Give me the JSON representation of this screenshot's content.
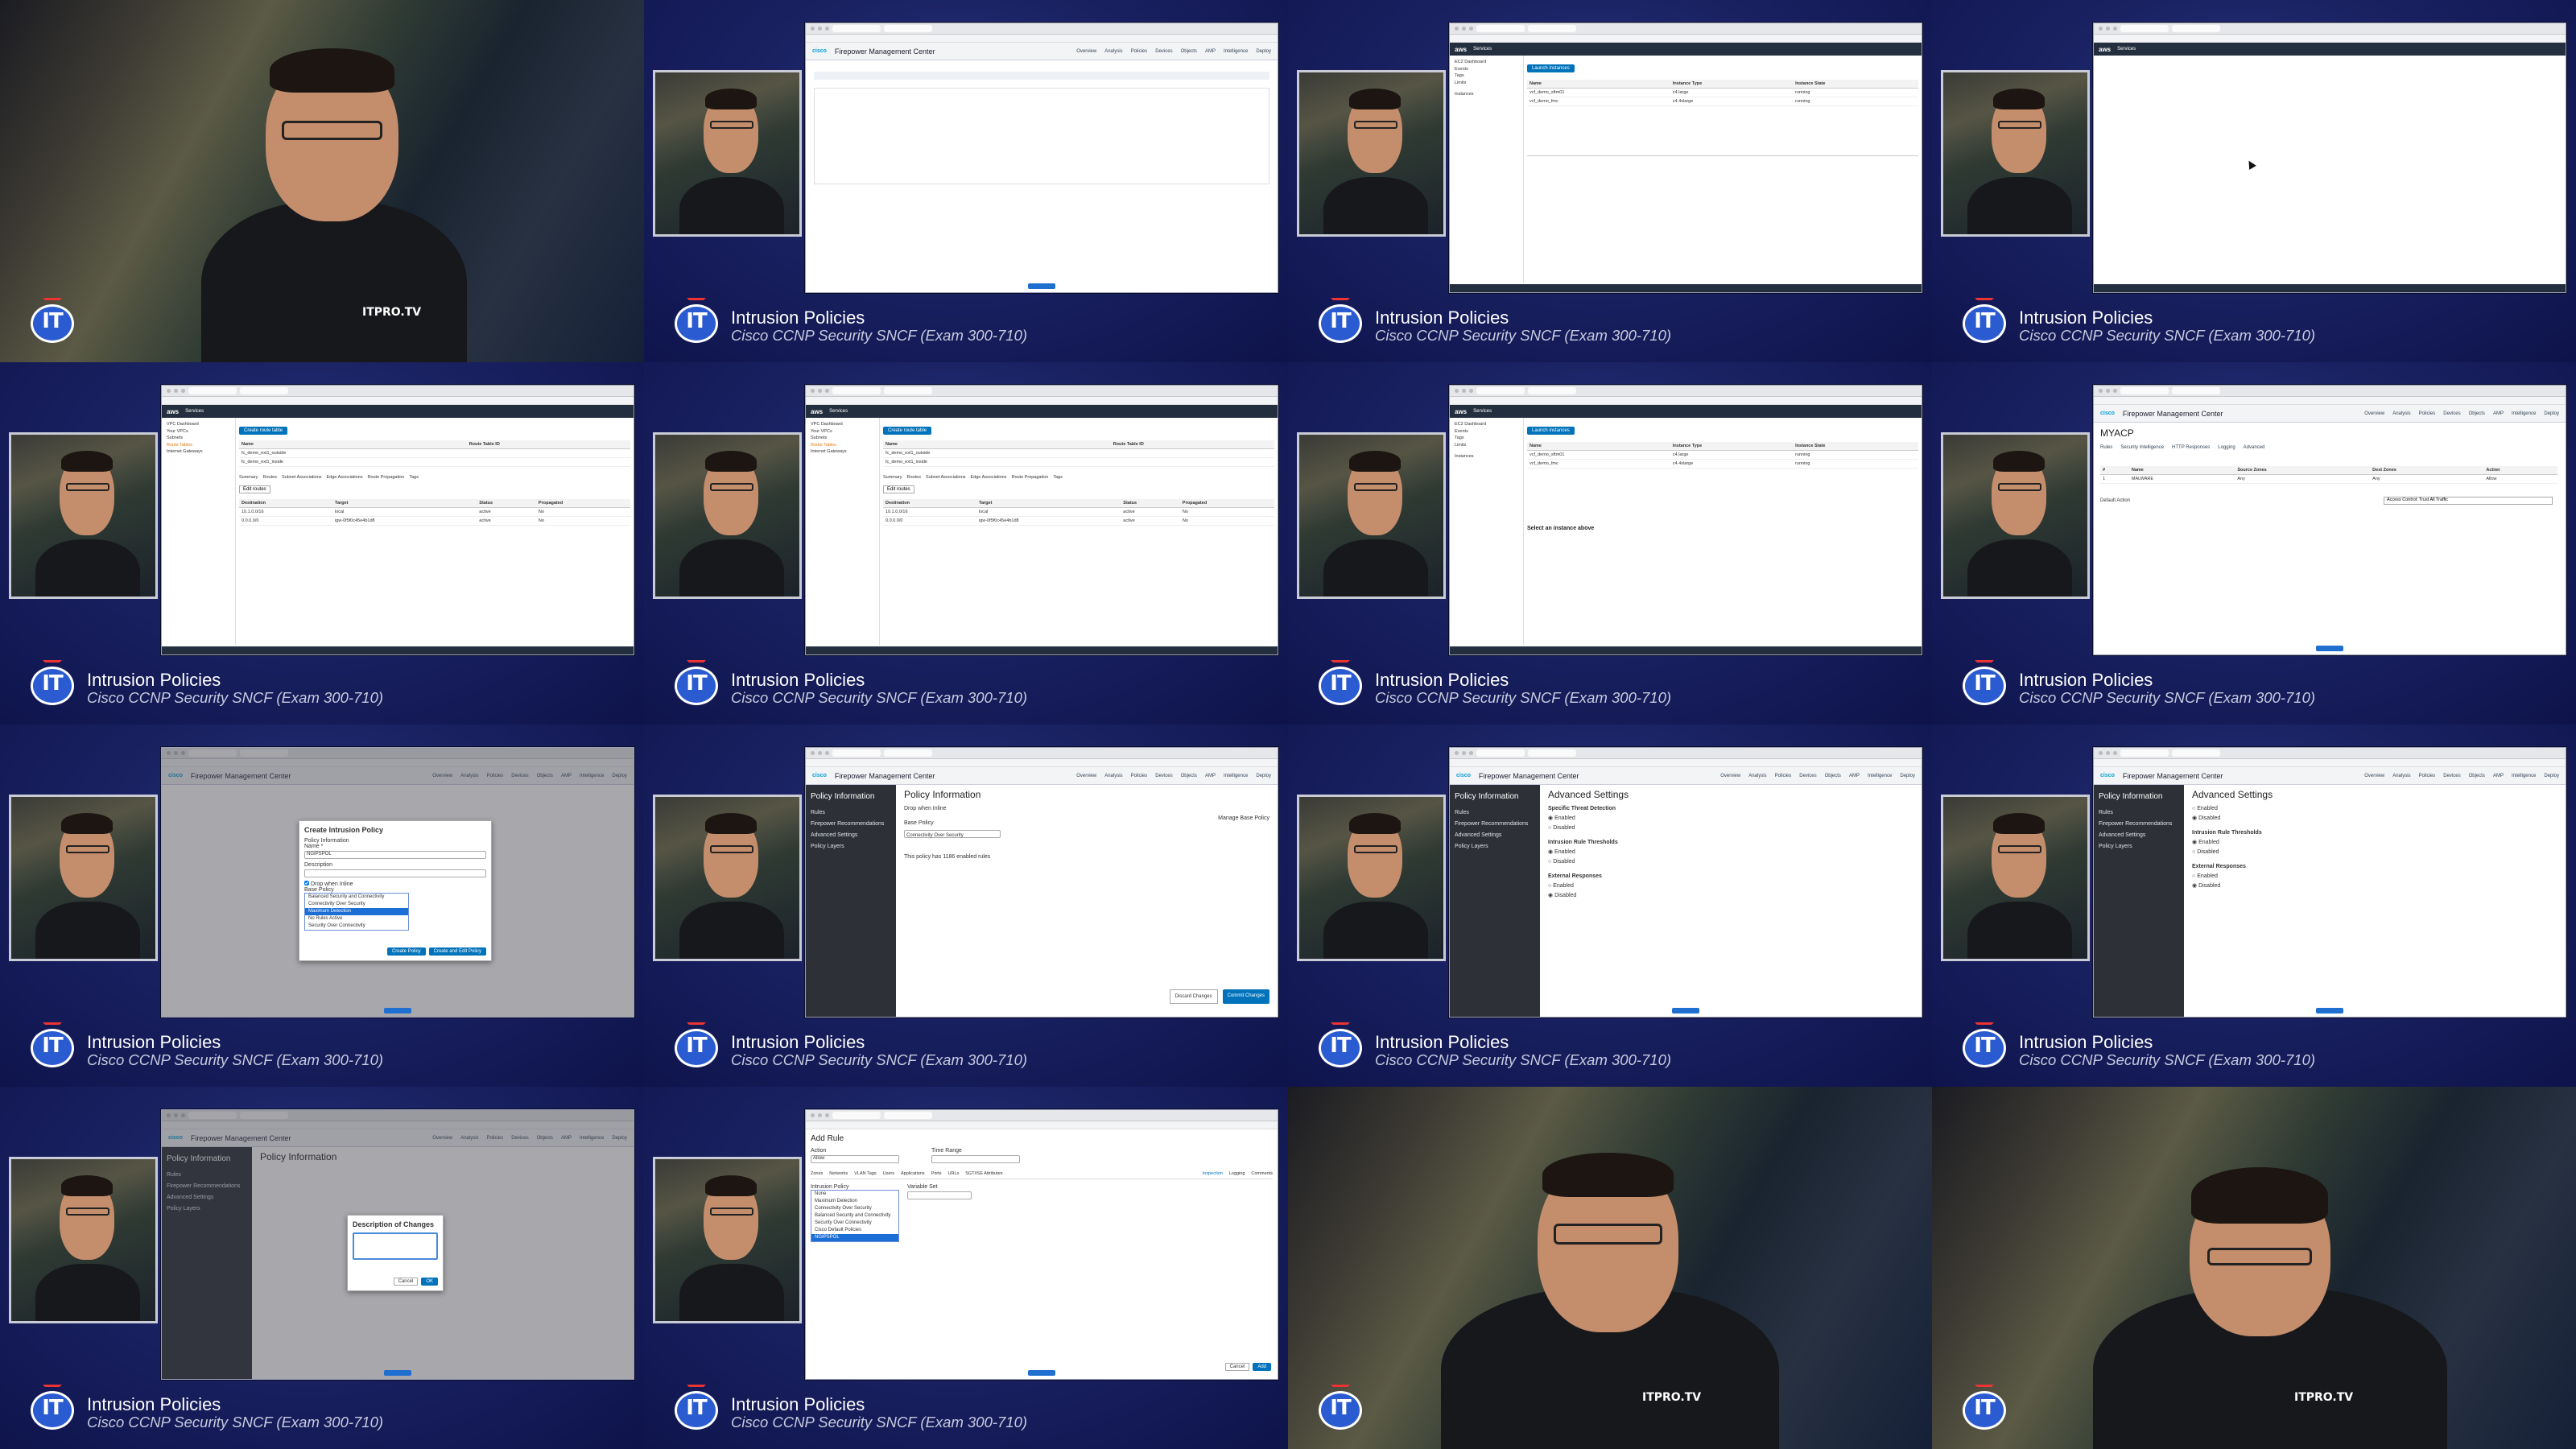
{
  "tile_title": "Intrusion Policies",
  "tile_subtitle": "Cisco CCNP Security SNCF (Exam 300-710)",
  "brand": {
    "mark": "IT",
    "shirt_logo": "ITPRO.TV"
  },
  "fmc": {
    "app_title": "Firepower Management Center",
    "nav": [
      "Overview",
      "Analysis",
      "Policies",
      "Devices",
      "Objects",
      "AMP",
      "Intelligence",
      "Deploy"
    ]
  },
  "aws": {
    "logo": "aws",
    "services": "Services",
    "ec2_dashboard": "EC2 Dashboard",
    "launch_instances": "Launch instances",
    "create_route_table": "Create route table",
    "instances_label": "Instances",
    "route_tables": "Route Tables",
    "edit_routes": "Edit routes",
    "select_instance": "Select an instance above",
    "instances": [
      {
        "name": "vcf_demo_sftm01",
        "type": "c4.large",
        "state": "running"
      },
      {
        "name": "vcf_demo_fmc",
        "type": "c4.4xlarge",
        "state": "running"
      }
    ],
    "route_tables_list": [
      {
        "name": "fc_demo_ext1_outside"
      },
      {
        "name": "fc_demo_ext1_inside"
      }
    ],
    "route_tabs": [
      "Summary",
      "Routes",
      "Subnet Associations",
      "Edge Associations",
      "Route Propagation",
      "Tags"
    ],
    "routes": [
      {
        "destination": "10.1.0.0/16",
        "target": "local",
        "status": "active",
        "propagated": "No"
      },
      {
        "destination": "0.0.0.0/0",
        "target": "igw-0f5f0c45e4b1d8",
        "status": "active",
        "propagated": "No"
      }
    ]
  },
  "myacp": {
    "name": "MYACP",
    "tabs": [
      "Rules",
      "Security Intelligence",
      "HTTP Responses",
      "Logging",
      "Advanced"
    ],
    "rule": "MALWARE",
    "default_action": "Access Control: Trust All Traffic"
  },
  "create_policy": {
    "title": "Create Intrusion Policy",
    "policy_info": "Policy Information",
    "name_label": "Name *",
    "name_value": "NGIPSPOL",
    "description_label": "Description",
    "drop_label": "Drop when Inline",
    "base_label": "Base Policy",
    "options": [
      "Balanced Security and Connectivity",
      "Connectivity Over Security",
      "Maximum Detection",
      "No Rules Active",
      "Security Over Connectivity"
    ],
    "selected": "Maximum Detection",
    "create_btn": "Create Policy",
    "create_edit_btn": "Create and Edit Policy"
  },
  "policy_info": {
    "side_heading": "Policy Information",
    "side_items": [
      "Rules",
      "Firepower Recommendations",
      "Advanced Settings",
      "Policy Layers"
    ],
    "title": "Policy Information",
    "drop": "Drop when Inline",
    "base_policy": "Base Policy",
    "base_value": "Connectivity Over Security",
    "manage_base": "Manage Base Policy",
    "note": "This policy has 1186 enabled rules",
    "discard": "Discard Changes",
    "commit": "Commit Changes"
  },
  "advanced": {
    "title": "Advanced Settings",
    "sections": [
      "Specific Threat Detection",
      "Intrusion Rule Thresholds",
      "External Responses"
    ],
    "enabled": "Enabled",
    "disabled": "Disabled"
  },
  "description_dialog": {
    "title": "Description of Changes",
    "cancel": "Cancel",
    "ok": "OK"
  },
  "add_rule": {
    "title": "Add Rule",
    "action_label": "Action",
    "action_value": "Allow",
    "time_range": "Time Range",
    "tabs": [
      "Zones",
      "Networks",
      "VLAN Tags",
      "Users",
      "Applications",
      "Ports",
      "URLs",
      "SGT/ISE Attributes",
      "Inspection",
      "Logging",
      "Comments"
    ],
    "intrusion_label": "Intrusion Policy",
    "variable_label": "Variable Set",
    "intrusion_options": [
      "None",
      "Maximum Detection",
      "Connectivity Over Security",
      "Balanced Security and Connectivity",
      "Security Over Connectivity",
      "Cisco Default Policies",
      "NGIPSPOL"
    ],
    "selected": "NGIPSPOL",
    "cancel": "Cancel",
    "add": "Add"
  },
  "colors": {
    "bg": "#1a2263",
    "accent": "#2a5bd0",
    "fmc_blue": "#049fd9"
  }
}
